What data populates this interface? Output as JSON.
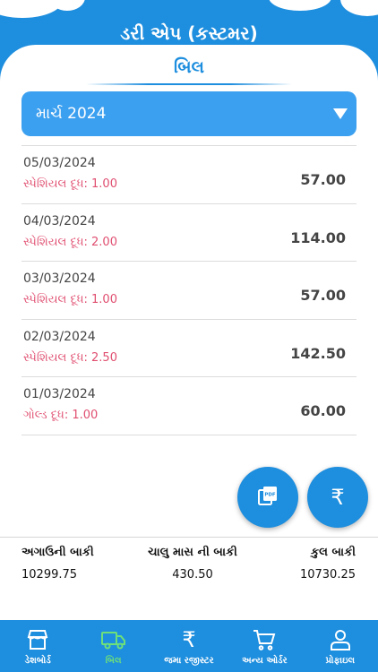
{
  "app": {
    "title": "ડરી એપ (કસ્ટમર)"
  },
  "page": {
    "title": "બિલ"
  },
  "month_select": {
    "value": "માર્ચ 2024"
  },
  "bills": [
    {
      "date": "05/03/2024",
      "item": "સ્પેશિયલ દૂધ: 1.00",
      "amount": "57.00"
    },
    {
      "date": "04/03/2024",
      "item": "સ્પેશિયલ દૂધ: 2.00",
      "amount": "114.00"
    },
    {
      "date": "03/03/2024",
      "item": "સ્પેશિયલ દૂધ: 1.00",
      "amount": "57.00"
    },
    {
      "date": "02/03/2024",
      "item": "સ્પેશિયલ દૂધ: 2.50",
      "amount": "142.50"
    },
    {
      "date": "01/03/2024",
      "item": "ગોલ્ડ દૂધ: 1.00",
      "amount": "60.00"
    }
  ],
  "fabs": {
    "pdf_icon": "pdf-icon",
    "rupee_icon": "rupee-icon",
    "rupee_glyph": "₹"
  },
  "summary": {
    "previous_label": "અગાઉની બાકી",
    "previous_value": "10299.75",
    "current_label": "ચાલુ માસ ની બાકી",
    "current_value": "430.50",
    "total_label": "કુલ બાકી",
    "total_value": "10730.25"
  },
  "nav": {
    "active": "bill",
    "items": [
      {
        "label": "ડેશબોર્ડ",
        "icon": "store-icon"
      },
      {
        "label": "બિલ",
        "icon": "truck-icon"
      },
      {
        "label": "જમા રજીસ્ટર",
        "icon": "rupee-icon"
      },
      {
        "label": "અન્ય ઓર્ડર",
        "icon": "cart-icon"
      },
      {
        "label": "પ્રોફાઇલ",
        "icon": "user-icon"
      }
    ]
  },
  "colors": {
    "primary": "#1e8ede",
    "select": "#3ca0f0",
    "item_text": "#e04e70",
    "active_nav": "#6ee07a"
  }
}
